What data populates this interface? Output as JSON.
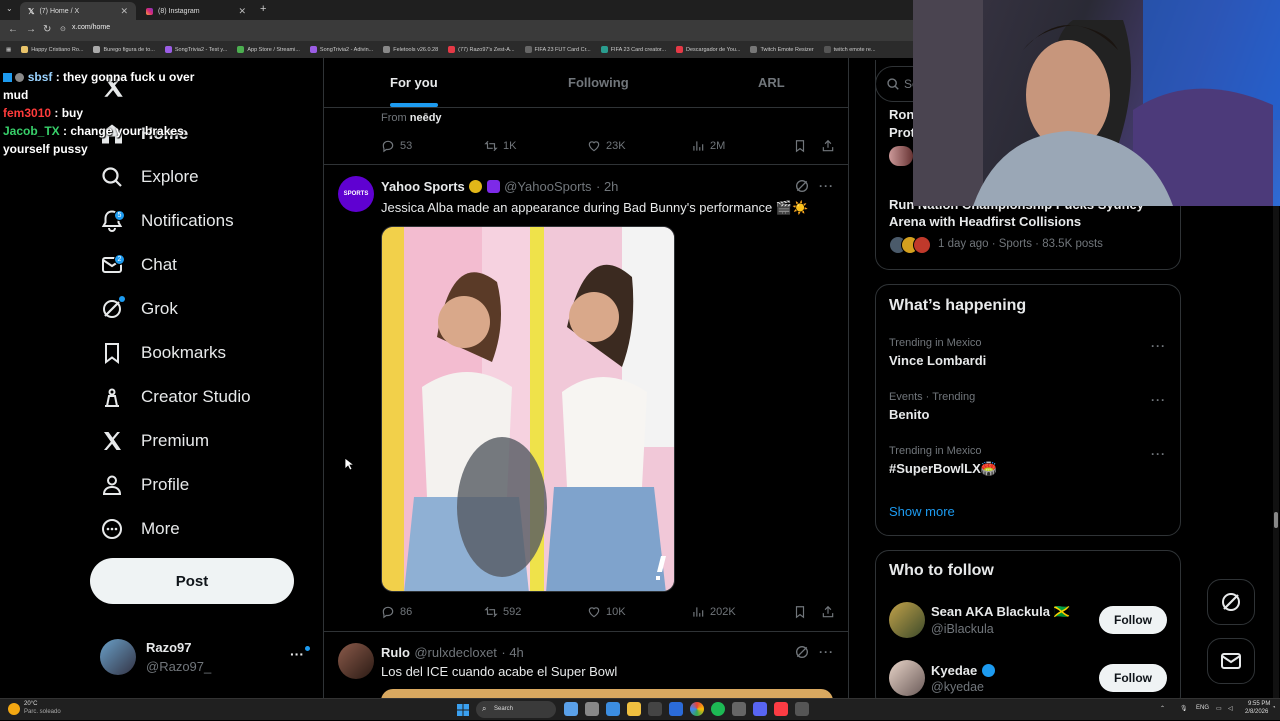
{
  "browser": {
    "tabs": [
      {
        "label": "(7) Home / X",
        "active": true
      },
      {
        "label": "(8) Instagram",
        "active": false
      }
    ],
    "url": "x.com/home",
    "bookmarks": [
      "Happy Cristiano Ro...",
      "Burego figura de to...",
      "SongTrivia2 - Test y...",
      "App Store / Streami...",
      "SongTrivia2 - Adivin...",
      "Feletools v26.0.28",
      "(77) Razo97's Zest-A...",
      "FIFA 23 FUT Card Cr...",
      "FIFA 23 Card creator...",
      "Descargador de You...",
      "Twitch Emote Resizer",
      "twitch emote re..."
    ]
  },
  "chat": [
    {
      "user": "sbsf",
      "color": "#9ad3ff",
      "message": " : they gonna fuck u over mud"
    },
    {
      "user": "fem3010",
      "color": "#ff3b3b",
      "message": " : buy"
    },
    {
      "user": "Jacob_TX",
      "color": "#38d06a",
      "message": " : change your brakes yourself pussy"
    }
  ],
  "sidebar": {
    "items": [
      {
        "label": "Home",
        "icon": "home-icon"
      },
      {
        "label": "Explore",
        "icon": "search-icon"
      },
      {
        "label": "Notifications",
        "icon": "bell-icon",
        "badge": "5"
      },
      {
        "label": "Chat",
        "icon": "mail-icon",
        "badge": "2"
      },
      {
        "label": "Grok",
        "icon": "grok-icon"
      },
      {
        "label": "Bookmarks",
        "icon": "bookmark-icon"
      },
      {
        "label": "Creator Studio",
        "icon": "creator-studio-icon"
      },
      {
        "label": "Premium",
        "icon": "x-logo-icon"
      },
      {
        "label": "Profile",
        "icon": "person-icon"
      },
      {
        "label": "More",
        "icon": "more-circle-icon"
      }
    ],
    "post_label": "Post",
    "profile": {
      "name": "Razo97",
      "handle": "@Razo97_"
    }
  },
  "timeline": {
    "tabs": [
      "For you",
      "Following",
      "ARL"
    ],
    "prev_tweet": {
      "from_prefix": "From",
      "from_name": "neēdy",
      "replies": "53",
      "reposts": "1K",
      "likes": "23K",
      "views": "2M"
    },
    "tweet1": {
      "name": "Yahoo Sports",
      "handle": "@YahooSports",
      "time": "· 2h",
      "text": "Jessica Alba made an appearance during Bad Bunny's performance 🎬☀️",
      "replies": "86",
      "reposts": "592",
      "likes": "10K",
      "views": "202K"
    },
    "tweet2": {
      "name": "Rulo",
      "handle": "@rulxdecloxet",
      "time": "· 4h",
      "text": "Los del ICE cuando acabe el Super Bowl"
    }
  },
  "right": {
    "search_placeholder": "Se",
    "live1": {
      "title": "Ron",
      "subtitle": "Prot"
    },
    "live2": {
      "title": "Run Nation Championship Pucks Sydney Arena with Headfirst Collisions",
      "meta": "1 day ago · Sports · 83.5K posts"
    },
    "whats_happening": {
      "title": "What’s happening",
      "trends": [
        {
          "context": "Trending in Mexico",
          "name": "Vince Lombardi"
        },
        {
          "context": "Events · Trending",
          "name": "Benito"
        },
        {
          "context": "Trending in Mexico",
          "name": "#SuperBowlLX🏟️"
        }
      ],
      "show_more": "Show more"
    },
    "who_to_follow": {
      "title": "Who to follow",
      "accounts": [
        {
          "name": "Sean AKA Blackula 🇯🇲",
          "handle": "@iBlackula",
          "button": "Follow"
        },
        {
          "name": "Kyedae",
          "handle": "@kyedae",
          "button": "Follow"
        }
      ]
    }
  },
  "taskbar": {
    "weather_temp": "20°C",
    "weather_desc": "Parc. soleado",
    "search": "Search",
    "lang": "ENG",
    "time": "9:55 PM",
    "date": "2/8/2026"
  }
}
